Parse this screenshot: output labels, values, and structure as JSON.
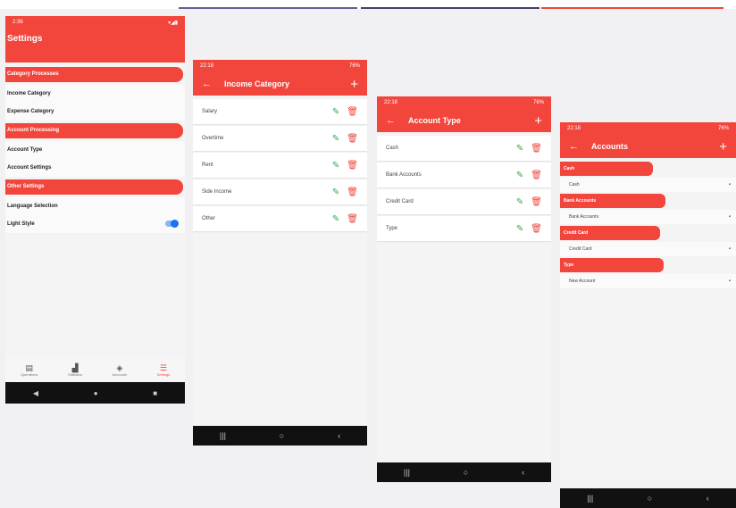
{
  "colors": {
    "accent": "#f2463d",
    "edit": "#3aa655",
    "toggle": "#1a73e8"
  },
  "settings_screen": {
    "status_time": "2:36",
    "title": "Settings",
    "sections": [
      {
        "label": "Category Processes",
        "items": [
          "Income Category",
          "Expense Category"
        ]
      },
      {
        "label": "Account Processing",
        "items": [
          "Account Type",
          "Account Settings"
        ]
      },
      {
        "label": "Other Settings",
        "items": [
          "Language Selection",
          "Light Style"
        ]
      }
    ],
    "light_style_enabled": true,
    "bottom_nav": [
      {
        "label": "Operations",
        "icon": "receipt-icon"
      },
      {
        "label": "Statistics",
        "icon": "bar-chart-icon"
      },
      {
        "label": "Accounts",
        "icon": "wallet-icon"
      },
      {
        "label": "Settings",
        "icon": "settings-list-icon"
      }
    ]
  },
  "income_category_screen": {
    "status_time": "22:18",
    "status_battery": "76%",
    "title": "Income Category",
    "rows": [
      "Salary",
      "Overtime",
      "Rent",
      "Side Income",
      "Other"
    ]
  },
  "account_type_screen": {
    "status_time": "22:18",
    "status_battery": "76%",
    "title": "Account Type",
    "rows": [
      "Cash",
      "Bank Accounts",
      "Credit Card",
      "Type"
    ]
  },
  "accounts_screen": {
    "status_time": "22:18",
    "status_battery": "76%",
    "title": "Accounts",
    "groups": [
      {
        "label": "Cash",
        "items": [
          "Cash"
        ]
      },
      {
        "label": "Bank Accounts",
        "items": [
          "Bank Accounts"
        ]
      },
      {
        "label": "Credit Card",
        "items": [
          "Credit Card"
        ]
      },
      {
        "label": "Type",
        "items": [
          "New Account"
        ]
      }
    ]
  }
}
